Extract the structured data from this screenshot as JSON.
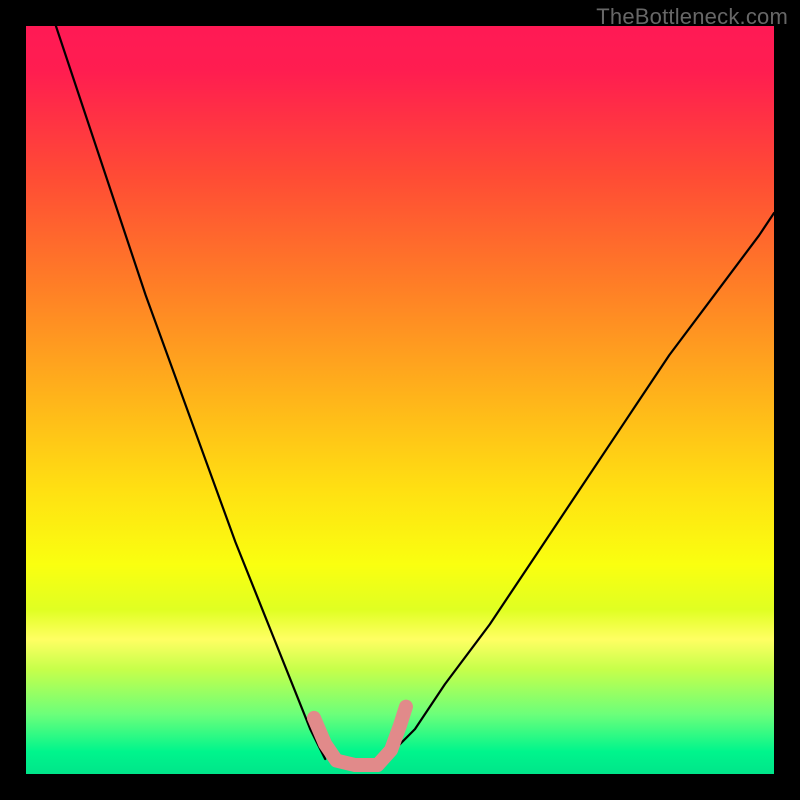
{
  "watermark": {
    "text": "TheBottleneck.com"
  },
  "chart_data": {
    "type": "line",
    "title": "",
    "xlabel": "",
    "ylabel": "",
    "xlim": [
      0,
      100
    ],
    "ylim": [
      0,
      100
    ],
    "background": {
      "type": "vertical-gradient",
      "stops": [
        {
          "offset": 0.0,
          "color": "#ff1a55"
        },
        {
          "offset": 0.06,
          "color": "#ff1d50"
        },
        {
          "offset": 0.2,
          "color": "#ff4b35"
        },
        {
          "offset": 0.35,
          "color": "#ff7f26"
        },
        {
          "offset": 0.5,
          "color": "#ffb51a"
        },
        {
          "offset": 0.62,
          "color": "#ffe012"
        },
        {
          "offset": 0.72,
          "color": "#faff10"
        },
        {
          "offset": 0.78,
          "color": "#e0ff22"
        },
        {
          "offset": 0.82,
          "color": "#ffff63"
        },
        {
          "offset": 0.86,
          "color": "#c6ff4a"
        },
        {
          "offset": 0.92,
          "color": "#6cff7a"
        },
        {
          "offset": 0.97,
          "color": "#00f58c"
        },
        {
          "offset": 1.0,
          "color": "#00e58a"
        }
      ]
    },
    "series": [
      {
        "name": "left-branch",
        "stroke": "#000000",
        "stroke_width": 2.2,
        "x": [
          4,
          8,
          12,
          16,
          20,
          24,
          28,
          32,
          36,
          38,
          40
        ],
        "y": [
          100,
          88,
          76,
          64,
          53,
          42,
          31,
          21,
          11,
          6,
          2
        ]
      },
      {
        "name": "right-branch",
        "stroke": "#000000",
        "stroke_width": 2.2,
        "x": [
          48,
          52,
          56,
          62,
          68,
          74,
          80,
          86,
          92,
          98,
          100
        ],
        "y": [
          2,
          6,
          12,
          20,
          29,
          38,
          47,
          56,
          64,
          72,
          75
        ]
      }
    ],
    "annotations": [
      {
        "name": "pink-marker",
        "stroke": "#e18a8a",
        "stroke_width": 14,
        "linecap": "round",
        "points": [
          {
            "x": 38.5,
            "y": 7.5
          },
          {
            "x": 40.0,
            "y": 4.0
          },
          {
            "x": 41.5,
            "y": 1.8
          },
          {
            "x": 44.0,
            "y": 1.2
          },
          {
            "x": 47.0,
            "y": 1.2
          },
          {
            "x": 48.8,
            "y": 3.2
          },
          {
            "x": 50.0,
            "y": 6.5
          },
          {
            "x": 50.8,
            "y": 9.0
          }
        ]
      }
    ]
  }
}
